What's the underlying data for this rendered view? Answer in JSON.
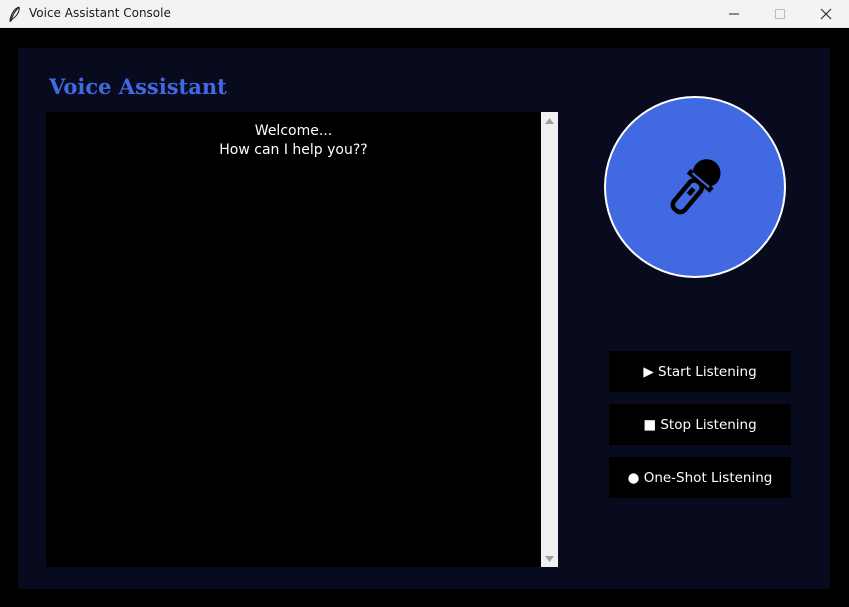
{
  "window": {
    "title": "Voice Assistant Console",
    "minimize_icon": "minimize-icon",
    "maximize_icon": "maximize-icon",
    "close_icon": "close-icon"
  },
  "app": {
    "heading": "Voice Assistant",
    "messages": [
      "Welcome...",
      "How can I help you??"
    ],
    "mic_icon": "microphone-icon"
  },
  "controls": {
    "start_label": "▶ Start Listening",
    "stop_label": "■ Stop Listening",
    "oneshot_label": "● One-Shot Listening"
  },
  "colors": {
    "accent": "#4169e1",
    "panel_bg": "#080a1e",
    "outer_bg": "#000000",
    "text": "#ffffff"
  }
}
